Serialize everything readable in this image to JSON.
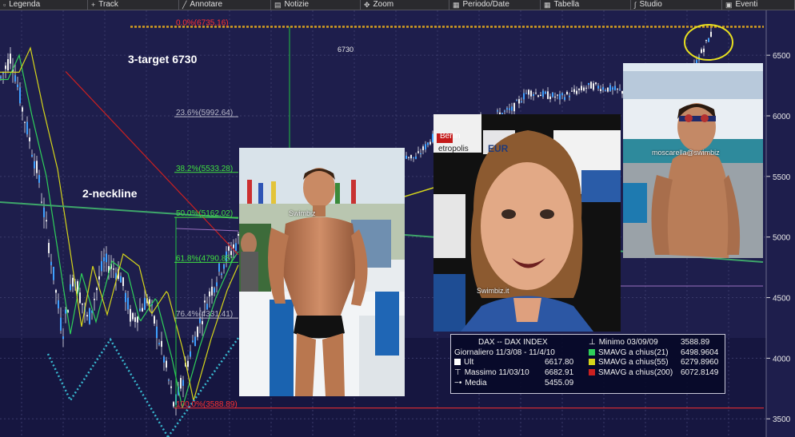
{
  "toolbar": {
    "items": [
      {
        "label": "Legenda",
        "icon": "square-icon",
        "glyph": "▫"
      },
      {
        "label": "Track",
        "icon": "plus-icon",
        "glyph": "+"
      },
      {
        "label": "Annotare",
        "icon": "pencil-icon",
        "glyph": "╱"
      },
      {
        "label": "Notizie",
        "icon": "note-icon",
        "glyph": "▤"
      },
      {
        "label": "Zoom",
        "icon": "zoom-icon",
        "glyph": "✥"
      },
      {
        "label": "Periodo/Date",
        "icon": "calendar-icon",
        "glyph": "▦"
      },
      {
        "label": "Tabella",
        "icon": "table-icon",
        "glyph": "▦"
      },
      {
        "label": "Studio",
        "icon": "study-icon",
        "glyph": "∫"
      },
      {
        "label": "Eventi",
        "icon": "events-icon",
        "glyph": "▣"
      }
    ]
  },
  "chart_data": {
    "type": "candlestick",
    "instrument": "DAX -- DAX INDEX",
    "period": "Giornaliero 11/3/08 - 11/4/10",
    "ylim": [
      3350,
      6870
    ],
    "y_ticks": [
      3500,
      4000,
      4500,
      5000,
      5500,
      6000,
      6500
    ],
    "fib_levels": [
      {
        "label": "0.0%(6735.16)",
        "value": 6735.16,
        "color": "#ff3030"
      },
      {
        "label": "23.6%(5992.64)",
        "value": 5992.64,
        "color": "#b8b8c8"
      },
      {
        "label": "38.2%(5533.28)",
        "value": 5533.28,
        "color": "#40e040"
      },
      {
        "label": "50.0%(5162.02)",
        "value": 5162.02,
        "color": "#40e040"
      },
      {
        "label": "61.8%(4790.85)",
        "value": 4790.85,
        "color": "#40e040"
      },
      {
        "label": "76.4%(4331.41)",
        "value": 4331.41,
        "color": "#b8b8c8"
      },
      {
        "label": "100.0%(3588.89)",
        "value": 3588.89,
        "color": "#ff3030"
      }
    ],
    "annotations": {
      "target": "3-target 6730",
      "neckline": "2-neckline",
      "target_value": "6730"
    },
    "series_colors": {
      "price": "#3fa0ff",
      "sma21": "#2fd05a",
      "sma55": "#d6d61a",
      "sma200": "#cc2020"
    },
    "legend": {
      "title": "DAX -- DAX INDEX",
      "period": "Giornaliero 11/3/08 - 11/4/10",
      "ult_label": "Ult",
      "ult_value": "6617.80",
      "max_label": "Massimo 11/03/10",
      "max_value": "6682.91",
      "media_label": "Media",
      "media_value": "5455.09",
      "min_label": "Minimo 03/09/09",
      "min_value": "3588.89",
      "sma21_label": "SMAVG a chius(21)",
      "sma21_value": "6498.9604",
      "sma55_label": "SMAVG a chius(55)",
      "sma55_value": "6279.8960",
      "sma200_label": "SMAVG a chius(200)",
      "sma200_value": "6072.8149"
    }
  },
  "overlays": {
    "watermark_1": "Swimbiz",
    "watermark_2": "Swimbiz.it",
    "watermark_3": "moscarella@swimbiz",
    "banner_text": "Berlin",
    "banner_text_2": "etropolis",
    "banner_text_3": "EUR"
  }
}
